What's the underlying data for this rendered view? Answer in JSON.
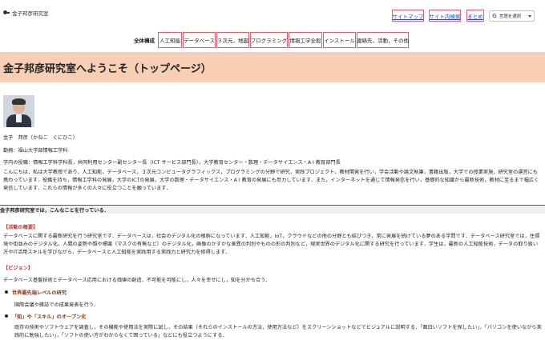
{
  "header": {
    "site_title": "金子邦彦研究室",
    "links": [
      {
        "label": "サイトマップ"
      },
      {
        "label": "サイト内検索"
      },
      {
        "label": "まとめ"
      }
    ],
    "translate": {
      "label": "言語を選択",
      "icon": "google-g-icon"
    }
  },
  "nav": {
    "label": "全体構成",
    "items": [
      {
        "label": "人工知能"
      },
      {
        "label": "データベース"
      },
      {
        "label": "３次元，地図"
      },
      {
        "label": "プログラミング"
      },
      {
        "label": "情報工学全般"
      },
      {
        "label": "インストール"
      },
      {
        "label": "連絡先，活動，その他"
      }
    ]
  },
  "hero": {
    "title": "金子邦彦研究室へようこそ（トップページ）"
  },
  "profile": {
    "name": "金子　邦彦（かねこ　くにひこ）",
    "affiliation": "勤務：福山大学部情報工学科",
    "roles": "学内の役職：情報工学科学科長，共同利用センター副センター長（ICT サービス部門長），大学教育センター・数理・データサイエンス・A I 教育部門長",
    "intro": "こんにちは．私は大学教授であり，人工知能，データベース，３次元コンピュータグラフィックス，プログラミングの分野で研究，実践プロジェクト，教材開発を行い，学会活動や論文執筆，書籍出版，大学での授業実施，研究室の運営にも携わっています．役職を持ち，情報工学科の発展，大学のICTの発展，大学の数理・データサイエンス・A I 教育の発展にも尽力しています．また，インターネットを通じて情報発信を行い，基礎的な知識から最新技術，教材に至るまで幅広く発信しています．これらの情報が多くの人々に役立つことを願っています．"
  },
  "section": {
    "title": "金子邦彦研究室では，こんなことを行っている．",
    "overview_head": "【活動の概要】",
    "overview": "データベースに関する最新研究を行う研究室です．データベースは，社会のデジタル化の根幹になっています．人工知能，IoT，クラウドなどの他の分野とも結びつき，常に発展を続けている夢のある学問です．データベース研究室では，住環境や街並みのデジタル化，人間の姿勢や顔や標識（マスクの有無など）のデジタル化，画像のかすかな差異の判別やものの形の判別など，現実世界のデジタル化に関する研究を行っています．学生は，最新の人工知能技術，データの取り扱い方やIT活用スキルを学びながら，データベースと人工知能を実践用する実践力と研究力を修得します．",
    "vision_head": "【ビジョン】",
    "vision": "データベース基盤技術とデータベース応用における価値の創造．不可能を可能にし，人々を幸せにし，知を分かち合う．",
    "bullets": [
      {
        "head": "世界最先端レベルの研究",
        "body": "国際会議や雑誌での成果発表を行う．"
      },
      {
        "head": "「知」や「スキル」のオープン化",
        "body": "既存の技術やソフトウェアを調査し，その機能や使用法を実際に試し，その結果（それらのインストールの方法，使用方法など）をスクリーンショットなどでビジュアルに説明する．「面白いソフトを探したい」，「パソコンを使いながら実践的に勉強したい」，「ソフトの使い方がわからなくて困っている」などにも役立つようにする．"
      }
    ]
  }
}
